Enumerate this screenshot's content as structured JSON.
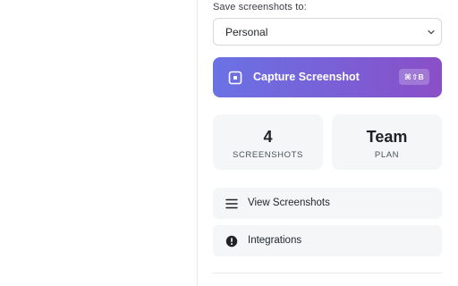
{
  "panel": {
    "save_label": "Save screenshots to:",
    "destination": {
      "selected": "Personal"
    },
    "capture": {
      "label": "Capture Screenshot",
      "shortcut": "⌘⇧B",
      "icon": "capture-square-icon"
    },
    "stats": [
      {
        "value": "4",
        "label": "SCREENSHOTS"
      },
      {
        "value": "Team",
        "label": "PLAN"
      }
    ],
    "nav": [
      {
        "label": "View Screenshots",
        "icon": "menu-icon"
      },
      {
        "label": "Integrations",
        "icon": "alert-circle-icon"
      }
    ]
  },
  "colors": {
    "accent_start": "#6a72e4",
    "accent_end": "#8a4fc7",
    "card_bg": "#f5f6f8"
  }
}
